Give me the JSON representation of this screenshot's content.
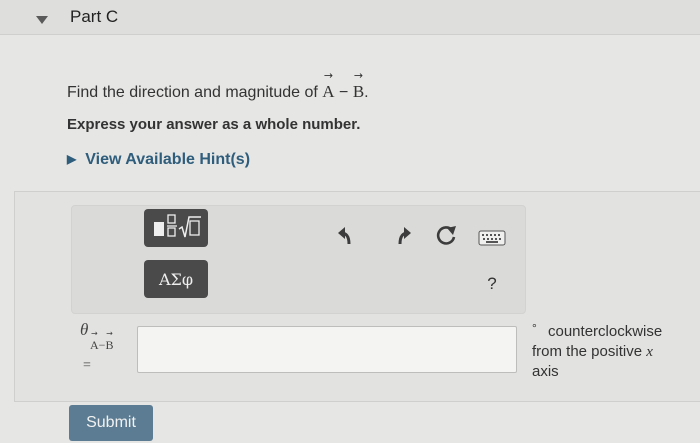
{
  "header": {
    "title": "Part C"
  },
  "question": {
    "text_before": "Find the direction and magnitude of ",
    "vector_a": "A",
    "operator": "−",
    "vector_b": "B",
    "text_after": "."
  },
  "instruction": "Express your answer as a whole number.",
  "hint": {
    "label": "View Available Hint(s)"
  },
  "toolbar": {
    "symbols_label": "ΑΣφ",
    "help_label": "?"
  },
  "answer": {
    "label_symbol": "θ",
    "label_sub_a": "A",
    "label_sub_op": "−",
    "label_sub_b": "B",
    "label_eq": "=",
    "value": "",
    "placeholder": ""
  },
  "units": {
    "degree_symbol": "°",
    "line1": "counterclockwise",
    "line2_prefix": "from the positive ",
    "variable": "x",
    "line3": "axis"
  },
  "submit": {
    "label": "Submit"
  }
}
